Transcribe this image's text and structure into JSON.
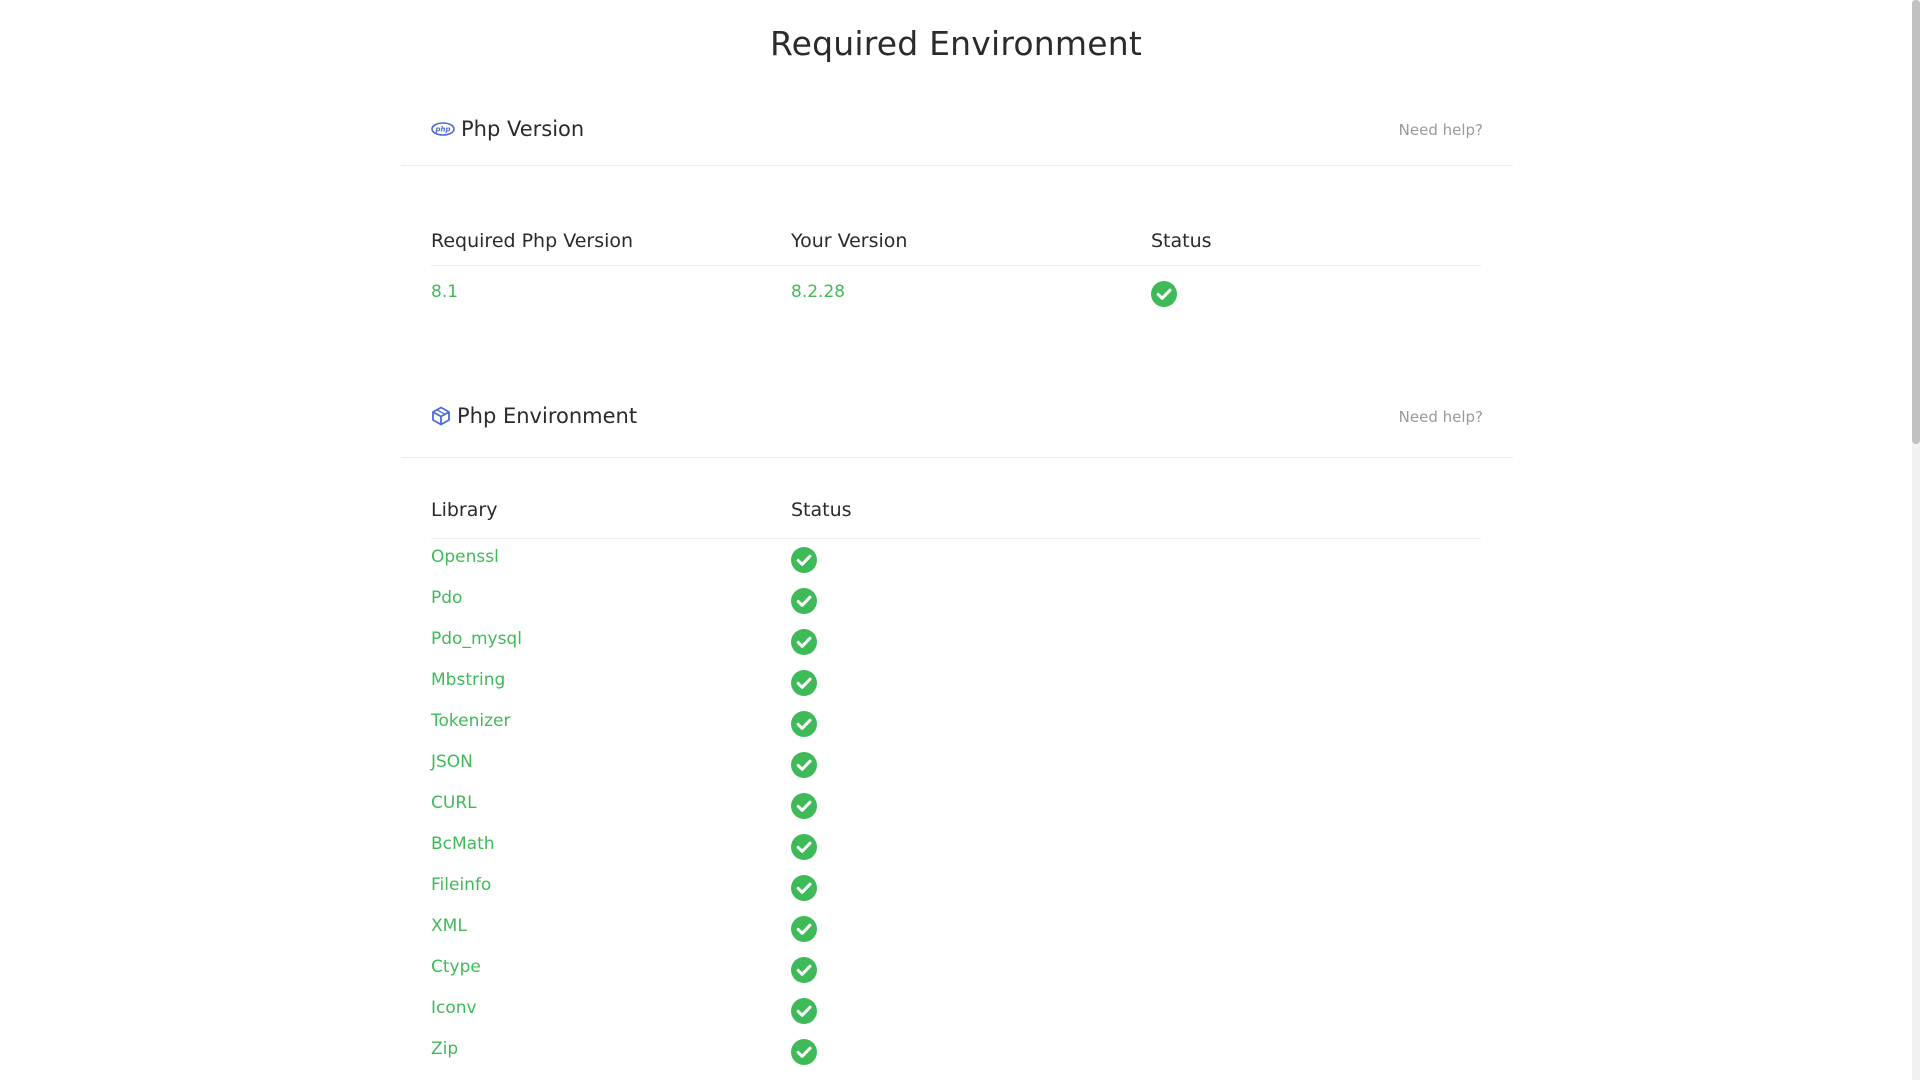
{
  "page": {
    "title": "Required Environment"
  },
  "php_version_section": {
    "title": "Php Version",
    "icon": "php-logo-icon",
    "help": "Need help?",
    "columns": {
      "required": "Required Php Version",
      "yours": "Your Version",
      "status": "Status"
    },
    "row": {
      "required": "8.1",
      "yours": "8.2.28",
      "status_icon": "check-circle-icon"
    }
  },
  "php_env_section": {
    "title": "Php Environment",
    "icon": "cube-icon",
    "help": "Need help?",
    "columns": {
      "library": "Library",
      "status": "Status"
    },
    "libraries": [
      "Openssl",
      "Pdo",
      "Pdo_mysql",
      "Mbstring",
      "Tokenizer",
      "JSON",
      "CURL",
      "BcMath",
      "Fileinfo",
      "XML",
      "Ctype",
      "Iconv",
      "Zip"
    ]
  },
  "colors": {
    "success": "#3fba59",
    "icon_blue": "#4f6bd9",
    "muted": "#9a9a9a",
    "text": "#2b2b2b"
  }
}
